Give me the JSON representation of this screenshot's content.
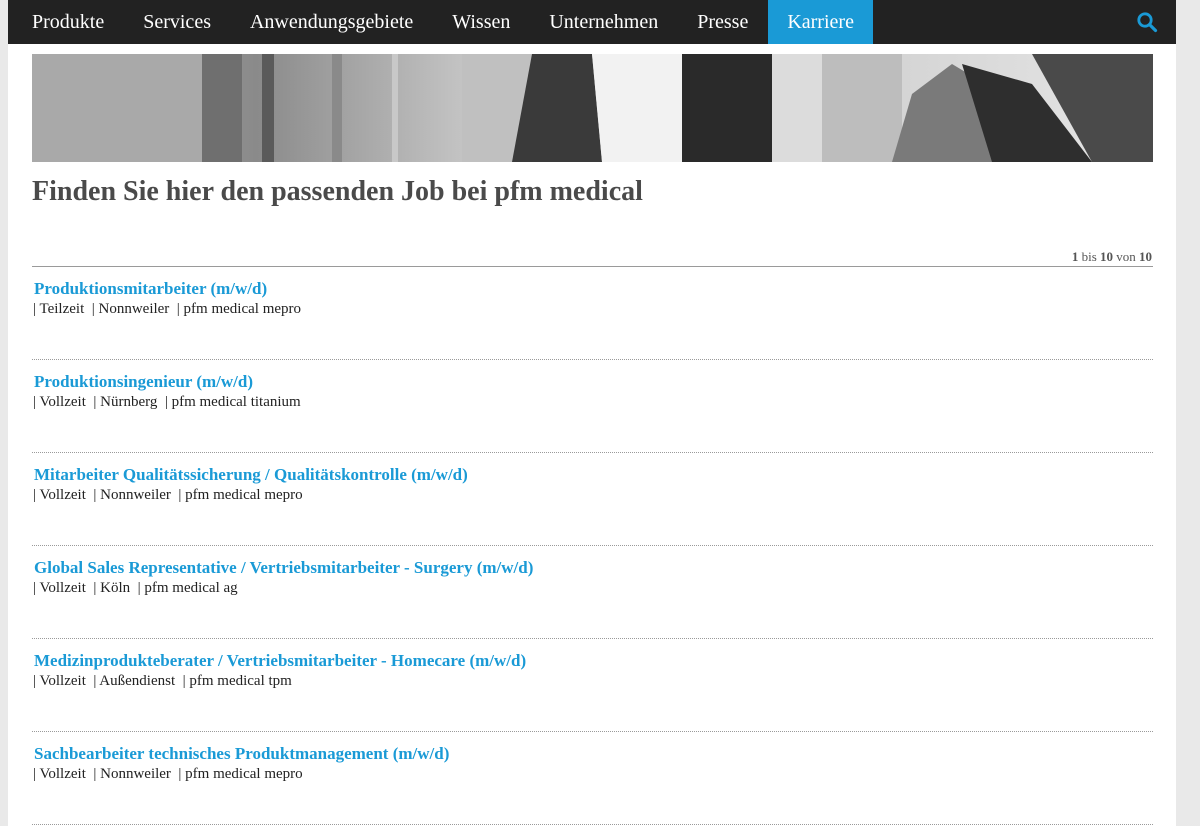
{
  "nav": {
    "items": [
      {
        "label": "Produkte"
      },
      {
        "label": "Services"
      },
      {
        "label": "Anwendungsgebiete"
      },
      {
        "label": "Wissen"
      },
      {
        "label": "Unternehmen"
      },
      {
        "label": "Presse"
      },
      {
        "label": "Karriere",
        "active": true
      }
    ],
    "search_icon": "search-icon"
  },
  "colors": {
    "nav_bg": "#222222",
    "accent": "#1a9ad6",
    "title": "#4a4a4a"
  },
  "page_title": "Finden Sie hier den passenden Job bei pfm medical",
  "pager": {
    "from": "1",
    "bis": "bis",
    "to": "10",
    "von": "von",
    "total": "10"
  },
  "jobs": [
    {
      "title": "Produktionsmitarbeiter (m/w/d)",
      "meta": "| Teilzeit  | Nonnweiler  | pfm medical mepro"
    },
    {
      "title": "Produktionsingenieur (m/w/d)",
      "meta": "| Vollzeit  | Nürnberg  | pfm medical titanium"
    },
    {
      "title": "Mitarbeiter Qualitätssicherung / Qualitätskontrolle (m/w/d)",
      "meta": "| Vollzeit  | Nonnweiler  | pfm medical mepro"
    },
    {
      "title": "Global Sales Representative / Vertriebsmitarbeiter - Surgery (m/w/d)",
      "meta": "| Vollzeit  | Köln  | pfm medical ag"
    },
    {
      "title": "Medizinprodukteberater / Vertriebsmitarbeiter - Homecare (m/w/d)",
      "meta": "| Vollzeit  | Außendienst  | pfm medical tpm"
    },
    {
      "title": "Sachbearbeiter technisches Produktmanagement (m/w/d)",
      "meta": "| Vollzeit  | Nonnweiler  | pfm medical mepro"
    }
  ]
}
